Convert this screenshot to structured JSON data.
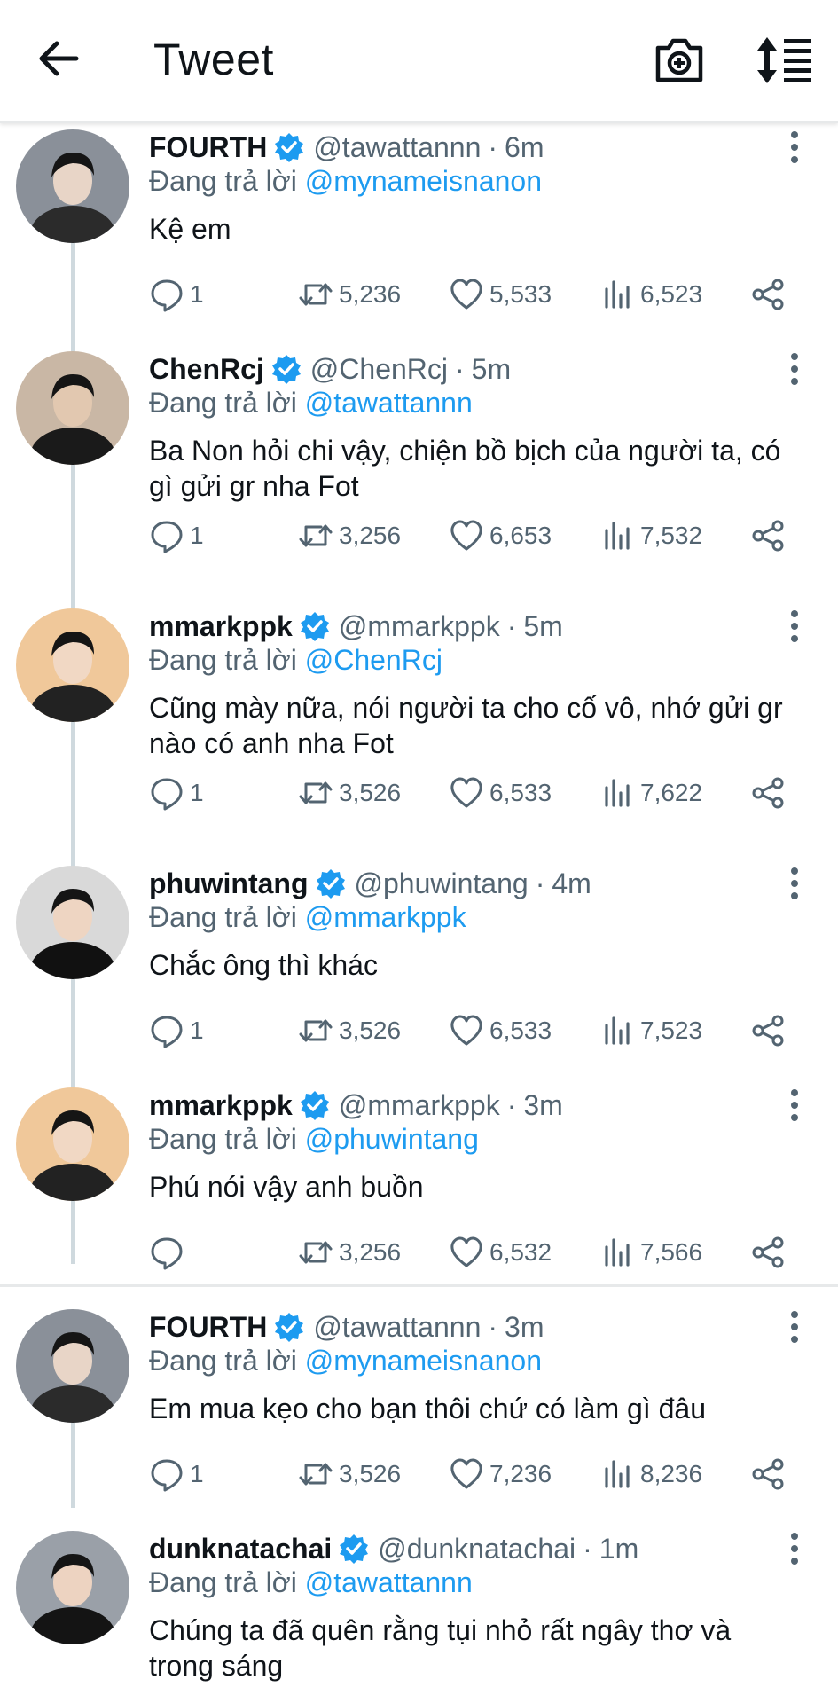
{
  "header": {
    "title": "Tweet",
    "icons": [
      "back-arrow-icon",
      "camera-plus-icon",
      "sort-icon"
    ]
  },
  "colors": {
    "accent": "#1d9bf0",
    "text": "#0f1419",
    "muted": "#536471",
    "divider": "#e7e9ea"
  },
  "reply_prefix": "Đang trả lời",
  "tweets": [
    {
      "name": "FOURTH",
      "handle": "@tawattannn",
      "time": "6m",
      "reply_to": "@mynameisnanon",
      "text": "Kệ em",
      "replies": "1",
      "retweets": "5,236",
      "likes": "5,533",
      "views": "6,523"
    },
    {
      "name": "ChenRcj",
      "handle": "@ChenRcj",
      "time": "5m",
      "reply_to": "@tawattannn",
      "text": "Ba Non hỏi chi vậy, chiện bồ bịch của người ta, có gì gửi gr nha Fot",
      "replies": "1",
      "retweets": "3,256",
      "likes": "6,653",
      "views": "7,532"
    },
    {
      "name": "mmarkppk",
      "handle": "@mmarkppk",
      "time": "5m",
      "reply_to": "@ChenRcj",
      "text": "Cũng mày nữa, nói người ta cho cố vô, nhớ gửi gr nào có anh nha Fot",
      "replies": "1",
      "retweets": "3,526",
      "likes": "6,533",
      "views": "7,622"
    },
    {
      "name": "phuwintang",
      "handle": "@phuwintang",
      "time": "4m",
      "reply_to": "@mmarkppk",
      "text": "Chắc ông thì khác",
      "replies": "1",
      "retweets": "3,526",
      "likes": "6,533",
      "views": "7,523"
    },
    {
      "name": "mmarkppk",
      "handle": "@mmarkppk",
      "time": "3m",
      "reply_to": "@phuwintang",
      "text": "Phú nói vậy anh buồn",
      "replies": "",
      "retweets": "3,256",
      "likes": "6,532",
      "views": "7,566"
    },
    {
      "name": "FOURTH",
      "handle": "@tawattannn",
      "time": "3m",
      "reply_to": "@mynameisnanon",
      "text": "Em mua kẹo cho bạn thôi chứ có làm gì đâu",
      "replies": "1",
      "retweets": "3,526",
      "likes": "7,236",
      "views": "8,236"
    },
    {
      "name": "dunknatachai",
      "handle": "@dunknatachai",
      "time": "1m",
      "reply_to": "@tawattannn",
      "text": "Chúng ta đã quên rằng tụi nhỏ rất ngây thơ và trong sáng",
      "replies": "",
      "retweets": "",
      "likes": "",
      "views": ""
    }
  ]
}
